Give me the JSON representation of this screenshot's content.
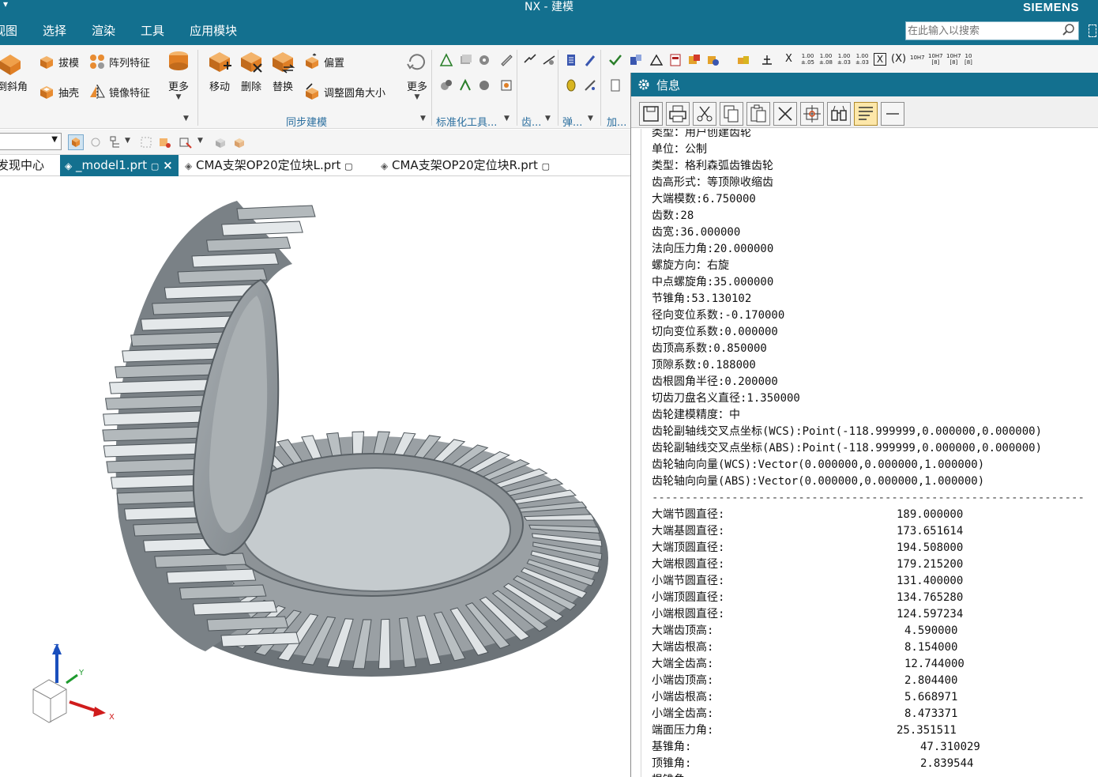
{
  "titlebar": {
    "title": "NX - 建模",
    "brand": "SIEMENS",
    "qa_glyph": "▾"
  },
  "menu": [
    "视图",
    "选择",
    "渲染",
    "工具",
    "应用模块"
  ],
  "search": {
    "placeholder": "在此输入以搜索"
  },
  "ribbon": {
    "feature_buttons": [
      "倒斜角",
      "拔模",
      "阵列特征",
      "抽壳",
      "镜像特征"
    ],
    "more1": "更多",
    "sync_buttons": [
      "移动",
      "删除",
      "替换"
    ],
    "offset": "偏置",
    "resize_blend": "调整圆角大小",
    "more2": "更多",
    "group_sync": "同步建模",
    "group_std": "标准化工具...",
    "group_gear": "齿...",
    "group_spring": "弹...",
    "group_add": "加...",
    "precision_labels": [
      "1.00",
      "1.00",
      "1.00",
      "1.00"
    ],
    "fit_labels": [
      "10H7",
      "10H7",
      "10H7",
      "10"
    ]
  },
  "tabs": {
    "items": [
      "发现中心",
      "_model1.prt",
      "CMA支架OP20定位块L.prt",
      "CMA支架OP20定位块R.prt"
    ],
    "close": "×"
  },
  "viewport": {
    "axis_x": "X",
    "axis_y": "Y",
    "axis_z": "Z"
  },
  "info": {
    "title": "信息",
    "top_lines": [
      "类型：用户创建齿轮",
      "单位：公制",
      "类型：格利森弧齿锥齿轮",
      "齿高形式：等顶隙收缩齿",
      "大端模数:6.750000",
      "齿数:28",
      "齿宽:36.000000",
      "法向压力角:20.000000",
      "螺旋方向：右旋",
      "中点螺旋角:35.000000",
      "节锥角:53.130102",
      "径向变位系数:-0.170000",
      "切向变位系数:0.000000",
      "齿顶高系数:0.850000",
      "顶隙系数:0.188000",
      "齿根圆角半径:0.200000",
      "切齿刀盘名义直径:1.350000",
      "齿轮建模精度：中",
      "齿轮副轴线交叉点坐标(WCS):Point(-118.999999,0.000000,0.000000)",
      "齿轮副轴线交叉点坐标(ABS):Point(-118.999999,0.000000,0.000000)",
      "齿轮轴向向量(WCS):Vector(0.000000,0.000000,1.000000)",
      "齿轮轴向向量(ABS):Vector(0.000000,0.000000,1.000000)"
    ],
    "separator": "-----------------------------------------------------------------",
    "params": [
      {
        "k": "大端节圆直径:",
        "v": "189.000000"
      },
      {
        "k": "大端基圆直径:",
        "v": "173.651614"
      },
      {
        "k": "大端顶圆直径:",
        "v": "194.508000"
      },
      {
        "k": "大端根圆直径:",
        "v": "179.215200"
      },
      {
        "k": "小端节圆直径:",
        "v": "131.400000"
      },
      {
        "k": "小端顶圆直径:",
        "v": "134.765280"
      },
      {
        "k": "小端根圆直径:",
        "v": "124.597234"
      },
      {
        "k": "大端齿顶高:",
        "v": "4.590000"
      },
      {
        "k": "大端齿根高:",
        "v": "8.154000"
      },
      {
        "k": "大端全齿高:",
        "v": "12.744000"
      },
      {
        "k": "小端齿顶高:",
        "v": "2.804400"
      },
      {
        "k": "小端齿根高:",
        "v": "5.668971"
      },
      {
        "k": "小端全齿高:",
        "v": "8.473371"
      },
      {
        "k": "端面压力角:",
        "v": "25.351511"
      },
      {
        "k": "基锥角:",
        "v": "47.310029"
      },
      {
        "k": "顶锥角:",
        "v": "2.839544"
      },
      {
        "k": "根锥角:",
        "v": ""
      }
    ]
  },
  "colors": {
    "titlebar": "#13708f",
    "ribbon_bg": "#f5f5f5",
    "group_label": "#2a6e9e",
    "gear_body": "#8e9499",
    "gear_face": "#c4cacd"
  }
}
